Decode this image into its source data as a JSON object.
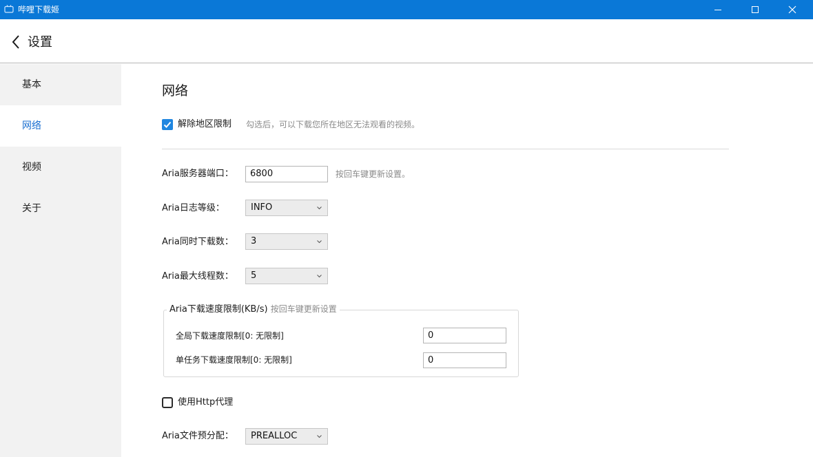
{
  "window": {
    "title": "哔哩下载姬",
    "title_bar_color": "#0a78d7",
    "icons": {
      "app": "tv-icon",
      "minimize": "minimize-icon",
      "maximize": "maximize-icon",
      "close": "close-icon"
    }
  },
  "header": {
    "back_icon": "chevron-left-icon",
    "title": "设置"
  },
  "sidebar": {
    "items": [
      {
        "label": "基本",
        "active": false
      },
      {
        "label": "网络",
        "active": true
      },
      {
        "label": "视频",
        "active": false
      },
      {
        "label": "关于",
        "active": false
      }
    ],
    "active_color": "#1a6fd0"
  },
  "main": {
    "section_title": "网络",
    "region_unlock": {
      "label": "解除地区限制",
      "checked": true,
      "hint": "勾选后，可以下载您所在地区无法观看的视频。"
    },
    "aria_port": {
      "label": "Aria服务器端口：",
      "value": "6800",
      "hint": "按回车键更新设置。"
    },
    "aria_log_level": {
      "label": "Aria日志等级：",
      "value": "INFO"
    },
    "aria_concurrent": {
      "label": "Aria同时下载数：",
      "value": "3"
    },
    "aria_max_threads": {
      "label": "Aria最大线程数：",
      "value": "5"
    },
    "speed_limit": {
      "legend": "Aria下载速度限制(KB/s)",
      "legend_hint": "按回车键更新设置",
      "global": {
        "label": "全局下载速度限制[0: 无限制]",
        "value": "0"
      },
      "per_task": {
        "label": "单任务下载速度限制[0: 无限制]",
        "value": "0"
      }
    },
    "http_proxy": {
      "label": "使用Http代理",
      "checked": false
    },
    "file_prealloc": {
      "label": "Aria文件预分配：",
      "value": "PREALLOC"
    }
  }
}
